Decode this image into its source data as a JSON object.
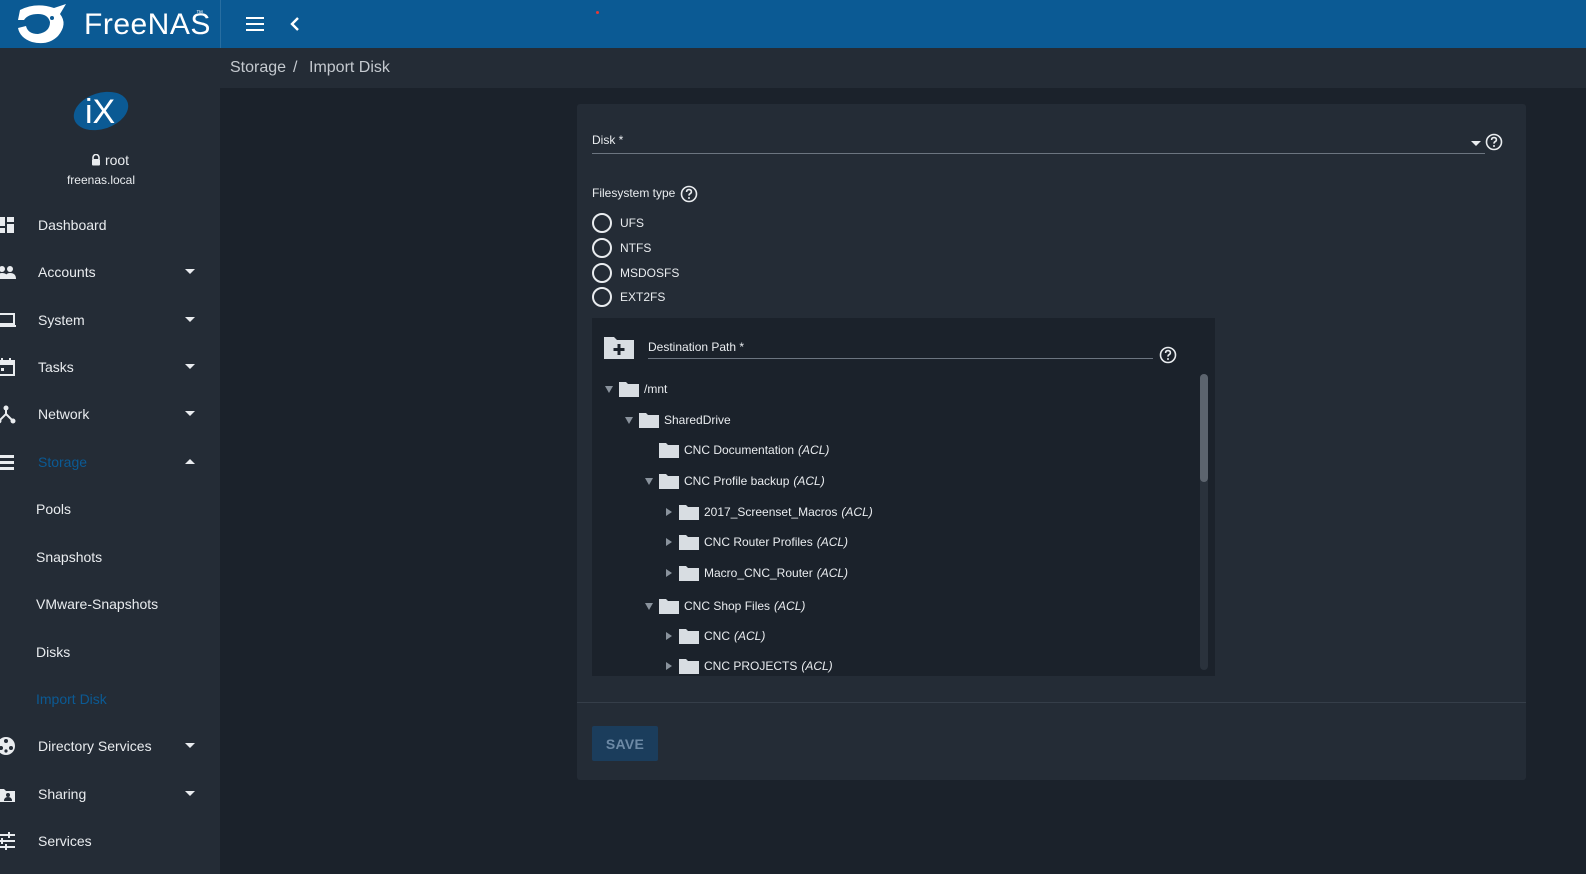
{
  "app": {
    "name": "FreeNAS",
    "trademark": "™"
  },
  "user": {
    "name": "root",
    "host": "freenas.local",
    "avatar_text": "iX"
  },
  "sidebar": {
    "items": [
      {
        "label": "Dashboard",
        "icon": "dashboard-icon"
      },
      {
        "label": "Accounts",
        "icon": "people-icon"
      },
      {
        "label": "System",
        "icon": "laptop-icon"
      },
      {
        "label": "Tasks",
        "icon": "calendar-icon"
      },
      {
        "label": "Network",
        "icon": "network-icon"
      },
      {
        "label": "Storage",
        "icon": "storage-icon"
      },
      {
        "label": "Pools"
      },
      {
        "label": "Snapshots"
      },
      {
        "label": "VMware-Snapshots"
      },
      {
        "label": "Disks"
      },
      {
        "label": "Import Disk"
      },
      {
        "label": "Directory Services",
        "icon": "directory-icon"
      },
      {
        "label": "Sharing",
        "icon": "sharing-icon"
      },
      {
        "label": "Services",
        "icon": "sliders-icon"
      }
    ]
  },
  "breadcrumb": {
    "parent": "Storage",
    "separator": "/",
    "current": "Import Disk"
  },
  "form": {
    "disk_label": "Disk *",
    "fs_label": "Filesystem type",
    "fs_options": [
      "UFS",
      "NTFS",
      "MSDOSFS",
      "EXT2FS"
    ],
    "dest_label": "Destination Path *",
    "tree": [
      {
        "name": "/mnt",
        "acl": ""
      },
      {
        "name": "SharedDrive",
        "acl": ""
      },
      {
        "name": "CNC Documentation",
        "acl": "(ACL)"
      },
      {
        "name": "CNC Profile backup",
        "acl": "(ACL)"
      },
      {
        "name": "2017_Screenset_Macros",
        "acl": "(ACL)"
      },
      {
        "name": "CNC Router Profiles",
        "acl": "(ACL)"
      },
      {
        "name": "Macro_CNC_Router",
        "acl": "(ACL)"
      },
      {
        "name": "CNC Shop Files",
        "acl": "(ACL)"
      },
      {
        "name": "CNC",
        "acl": "(ACL)"
      },
      {
        "name": "CNC PROJECTS",
        "acl": "(ACL)"
      }
    ],
    "save_label": "SAVE"
  },
  "colors": {
    "topbar": "#0b5a94",
    "sidebar": "#242c36",
    "background": "#1b222b",
    "active": "#0b5a94"
  }
}
